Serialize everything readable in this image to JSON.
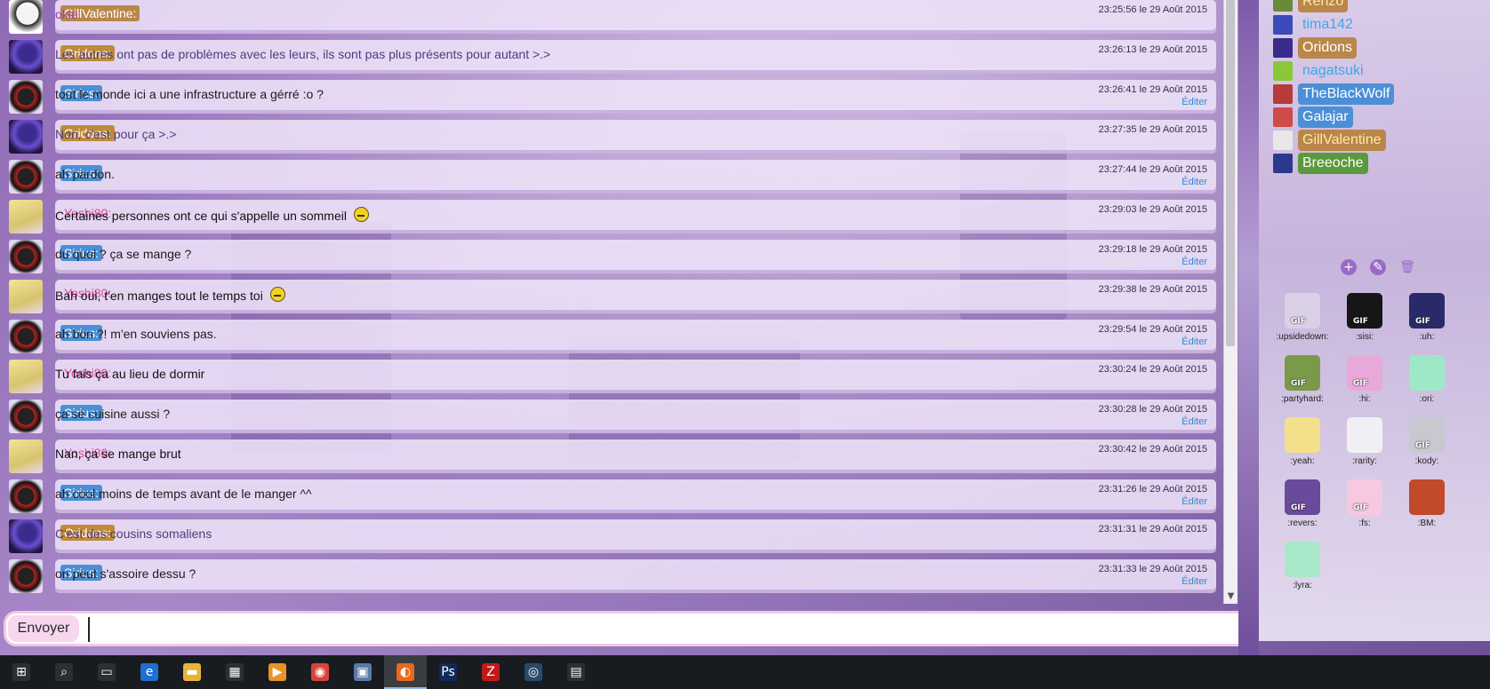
{
  "messages": [
    {
      "author": "GillValentine:",
      "text": "okie",
      "time": "23:25:56 le 29 Août 2015",
      "edit": "",
      "style": "gill",
      "avatar": "pony-white"
    },
    {
      "author": "Oridons:",
      "text": "Les autres ont pas de problèmes avec les leurs, ils sont pas plus présents pour autant >.>",
      "time": "23:26:13 le 29 Août 2015",
      "edit": "",
      "style": "oridons",
      "avatar": "pony-purple"
    },
    {
      "author": "Sirius:",
      "text": "tout le monde ici a une infrastructure a gérré :o ?",
      "time": "23:26:41 le 29 Août 2015",
      "edit": "Éditer",
      "style": "sirius",
      "avatar": "pony-black"
    },
    {
      "author": "Oridons:",
      "text": "Non, c'est pour ça >.>",
      "time": "23:27:35 le 29 Août 2015",
      "edit": "",
      "style": "oridons",
      "avatar": "pony-purple"
    },
    {
      "author": "Sirius:",
      "text": "ah pardon.",
      "time": "23:27:44 le 29 Août 2015",
      "edit": "Éditer",
      "style": "sirius",
      "avatar": "pony-black"
    },
    {
      "author": "Yoshi80:",
      "text": "Certaines personnes ont ce qui s'appelle un sommeil",
      "time": "23:29:03 le 29 Août 2015",
      "edit": "",
      "style": "yoshi",
      "avatar": "pony-yellow",
      "smiley": true
    },
    {
      "author": "Sirius:",
      "text": "du quoi ? ça se mange ?",
      "time": "23:29:18 le 29 Août 2015",
      "edit": "Éditer",
      "style": "sirius",
      "avatar": "pony-black"
    },
    {
      "author": "Yoshi80:",
      "text": "Bah oui, t'en manges tout le temps toi",
      "time": "23:29:38 le 29 Août 2015",
      "edit": "",
      "style": "yoshi",
      "avatar": "pony-yellow",
      "smiley": true
    },
    {
      "author": "Sirius:",
      "text": "ah bon ?! m'en souviens pas.",
      "time": "23:29:54 le 29 Août 2015",
      "edit": "Éditer",
      "style": "sirius",
      "avatar": "pony-black"
    },
    {
      "author": "Yoshi80:",
      "text": "Tu fais ça au lieu de dormir",
      "time": "23:30:24 le 29 Août 2015",
      "edit": "",
      "style": "yoshi",
      "avatar": "pony-yellow"
    },
    {
      "author": "Sirius:",
      "text": "ça se cuisine aussi ?",
      "time": "23:30:28 le 29 Août 2015",
      "edit": "Éditer",
      "style": "sirius",
      "avatar": "pony-black"
    },
    {
      "author": "Yoshi80:",
      "text": "Nan, ça se mange brut",
      "time": "23:30:42 le 29 Août 2015",
      "edit": "",
      "style": "yoshi",
      "avatar": "pony-yellow"
    },
    {
      "author": "Sirius:",
      "text": "ah cool moins de temps avant de le manger ^^",
      "time": "23:31:26 le 29 Août 2015",
      "edit": "Éditer",
      "style": "sirius",
      "avatar": "pony-black"
    },
    {
      "author": "Oridons:",
      "text": "C'est des cousins somaliens",
      "time": "23:31:31 le 29 Août 2015",
      "edit": "",
      "style": "oridons",
      "avatar": "pony-purple"
    },
    {
      "author": "Sirius:",
      "text": "on peut s'assoire dessu ?",
      "time": "23:31:33 le 29 Août 2015",
      "edit": "Éditer",
      "style": "sirius",
      "avatar": "pony-black"
    }
  ],
  "input": {
    "send_label": "Envoyer",
    "value": "",
    "placeholder": ""
  },
  "users": [
    {
      "name": "Renzo",
      "bg": "#b9874a",
      "fg": "#ffe9a8"
    },
    {
      "name": "tima142",
      "bg": "transparent",
      "fg": "#3fa6e8"
    },
    {
      "name": "Oridons",
      "bg": "#b9874a",
      "fg": "#ffffff"
    },
    {
      "name": "nagatsuki",
      "bg": "transparent",
      "fg": "#3fa6e8"
    },
    {
      "name": "TheBlackWolf",
      "bg": "#4b8fd6",
      "fg": "#ffffff"
    },
    {
      "name": "Galajar",
      "bg": "#4b8fd6",
      "fg": "#ffffff"
    },
    {
      "name": "GillValentine",
      "bg": "#b9874a",
      "fg": "#ffe9a8"
    },
    {
      "name": "Breeoche",
      "bg": "#5a9a3a",
      "fg": "#ffffff"
    }
  ],
  "emotes": [
    {
      "label": ":upsidedown:",
      "gif": true,
      "color": "#d9d0e8"
    },
    {
      "label": ":sisi:",
      "gif": true,
      "color": "#161616"
    },
    {
      "label": ":uh:",
      "gif": true,
      "color": "#2a2a6a"
    },
    {
      "label": ":partyhard:",
      "gif": true,
      "color": "#7a9a4a"
    },
    {
      "label": ":hi:",
      "gif": true,
      "color": "#e8a8d8"
    },
    {
      "label": ":ori:",
      "gif": false,
      "color": "#9ee8c8"
    },
    {
      "label": ":yeah:",
      "gif": false,
      "color": "#f4e08a"
    },
    {
      "label": ":rarity:",
      "gif": false,
      "color": "#f0f0f4"
    },
    {
      "label": ":kody:",
      "gif": true,
      "color": "#c8c8d0"
    },
    {
      "label": ":revers:",
      "gif": true,
      "color": "#6a4a9a"
    },
    {
      "label": ":fs:",
      "gif": true,
      "color": "#f8c8e0"
    },
    {
      "label": ":BM:",
      "gif": false,
      "color": "#c04a2a"
    },
    {
      "label": ":lyra:",
      "gif": false,
      "color": "#a8e8c8"
    }
  ],
  "gif_label": "GIF",
  "taskbar": [
    {
      "name": "start-icon",
      "glyph": "⊞",
      "color": "#2b2e33",
      "active": false
    },
    {
      "name": "search-icon",
      "glyph": "⌕",
      "color": "#2b2e33",
      "active": false
    },
    {
      "name": "task-view-icon",
      "glyph": "▭",
      "color": "#2b2e33",
      "active": false
    },
    {
      "name": "edge-icon",
      "glyph": "e",
      "color": "#1f6fd1",
      "active": false
    },
    {
      "name": "file-explorer-icon",
      "glyph": "▬",
      "color": "#e8b33a",
      "active": false
    },
    {
      "name": "store-icon",
      "glyph": "▦",
      "color": "#2b2e33",
      "active": false
    },
    {
      "name": "media-icon",
      "glyph": "▶",
      "color": "#e8922a",
      "active": false
    },
    {
      "name": "chrome-icon",
      "glyph": "◉",
      "color": "#d8443a",
      "active": false
    },
    {
      "name": "remote-desktop-icon",
      "glyph": "▣",
      "color": "#5a7aa8",
      "active": false
    },
    {
      "name": "firefox-icon",
      "glyph": "◐",
      "color": "#e86a1a",
      "active": true
    },
    {
      "name": "photoshop-icon",
      "glyph": "Ps",
      "color": "#0f2a5a",
      "active": false
    },
    {
      "name": "filezilla-icon",
      "glyph": "Z",
      "color": "#c01a1a",
      "active": false
    },
    {
      "name": "steam-icon",
      "glyph": "◎",
      "color": "#2a4a6a",
      "active": false
    },
    {
      "name": "calculator-icon",
      "glyph": "▤",
      "color": "#2b2e33",
      "active": false
    }
  ]
}
